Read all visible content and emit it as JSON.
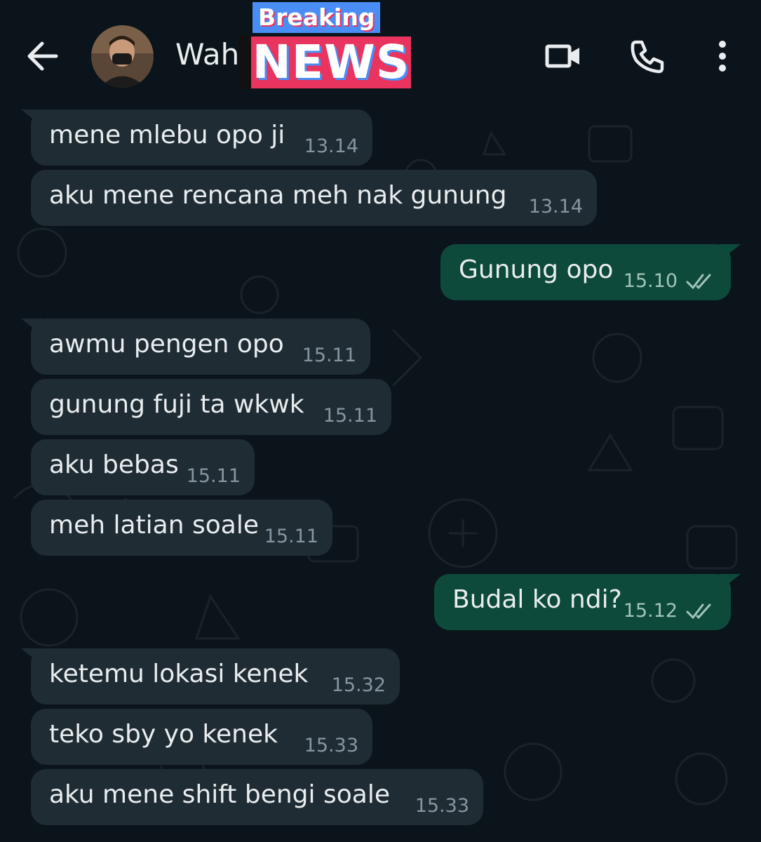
{
  "header": {
    "contact_name": "Wahyu",
    "badge_top": "Breaking",
    "badge_bottom": "NEWS"
  },
  "messages": [
    {
      "direction": "in",
      "text": "mene mlebu opo ji",
      "time": "13.14"
    },
    {
      "direction": "in",
      "text": "aku mene rencana meh nak gunung",
      "time": "13.14"
    },
    {
      "direction": "out",
      "text": "Gunung opo",
      "time": "15.10",
      "status": "read"
    },
    {
      "direction": "in",
      "text": "awmu pengen opo",
      "time": "15.11"
    },
    {
      "direction": "in",
      "text": "gunung fuji ta wkwk",
      "time": "15.11"
    },
    {
      "direction": "in",
      "text": "aku bebas",
      "time": "15.11"
    },
    {
      "direction": "in",
      "text": "meh latian soale",
      "time": "15.11"
    },
    {
      "direction": "out",
      "text": "Budal ko ndi?",
      "time": "15.12",
      "status": "read"
    },
    {
      "direction": "in",
      "text": "ketemu lokasi kenek",
      "time": "15.32"
    },
    {
      "direction": "in",
      "text": "teko sby yo kenek",
      "time": "15.33"
    },
    {
      "direction": "in",
      "text": "aku mene shift bengi soale",
      "time": "15.33"
    }
  ],
  "icons": {
    "back": "arrow-left-icon",
    "video": "video-camera-icon",
    "call": "phone-icon",
    "menu": "more-vertical-icon",
    "read_receipt": "double-check-icon"
  },
  "colors": {
    "background": "#0b141a",
    "incoming_bubble": "#202c33",
    "outgoing_bubble": "#0d4a3b",
    "breaking_blue": "#4a8ef5",
    "news_red": "#e8345e"
  }
}
